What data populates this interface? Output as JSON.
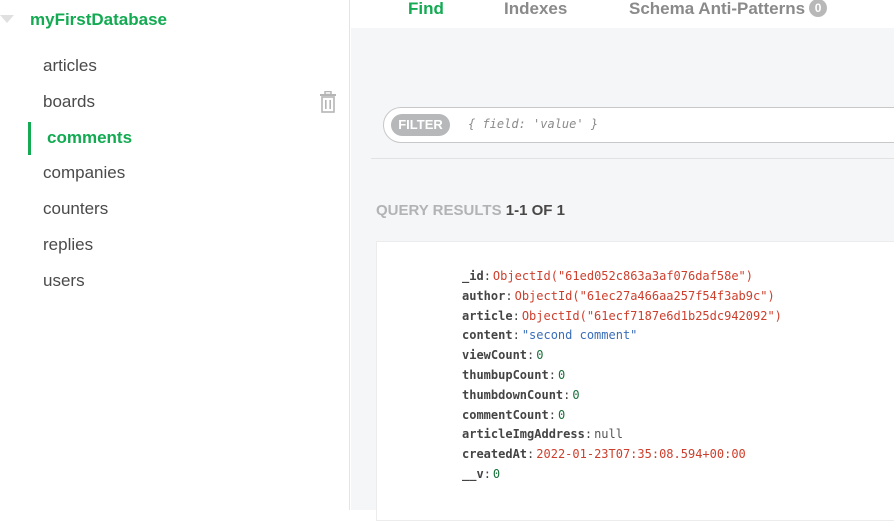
{
  "sidebar": {
    "database_name": "myFirstDatabase",
    "collections": [
      {
        "label": "articles",
        "active": false
      },
      {
        "label": "boards",
        "active": false
      },
      {
        "label": "comments",
        "active": true
      },
      {
        "label": "companies",
        "active": false
      },
      {
        "label": "counters",
        "active": false
      },
      {
        "label": "replies",
        "active": false
      },
      {
        "label": "users",
        "active": false
      }
    ]
  },
  "tabs": {
    "find": "Find",
    "indexes": "Indexes",
    "schema": "Schema Anti-Patterns",
    "schema_badge": "0"
  },
  "filter": {
    "button_label": "FILTER",
    "placeholder": "{ field: 'value' }"
  },
  "results": {
    "label": "QUERY RESULTS",
    "count": "1-1 OF 1"
  },
  "document": {
    "fields": [
      {
        "key": "_id",
        "value": "ObjectId(\"61ed052c863a3af076daf58e\")",
        "type": "oid"
      },
      {
        "key": "author",
        "value": "ObjectId(\"61ec27a466aa257f54f3ab9c\")",
        "type": "oid"
      },
      {
        "key": "article",
        "value": "ObjectId(\"61ecf7187e6d1b25dc942092\")",
        "type": "oid"
      },
      {
        "key": "content",
        "value": "\"second comment\"",
        "type": "str"
      },
      {
        "key": "viewCount",
        "value": "0",
        "type": "num"
      },
      {
        "key": "thumbupCount",
        "value": "0",
        "type": "num"
      },
      {
        "key": "thumbdownCount",
        "value": "0",
        "type": "num"
      },
      {
        "key": "commentCount",
        "value": "0",
        "type": "num"
      },
      {
        "key": "articleImgAddress",
        "value": "null",
        "type": "null"
      },
      {
        "key": "createdAt",
        "value": "2022-01-23T07:35:08.594+00:00",
        "type": "date"
      },
      {
        "key": "__v",
        "value": "0",
        "type": "num"
      }
    ]
  },
  "colors": {
    "accent": "#13aa52",
    "objectid": "#cd3f2d",
    "string": "#3b6db8"
  }
}
